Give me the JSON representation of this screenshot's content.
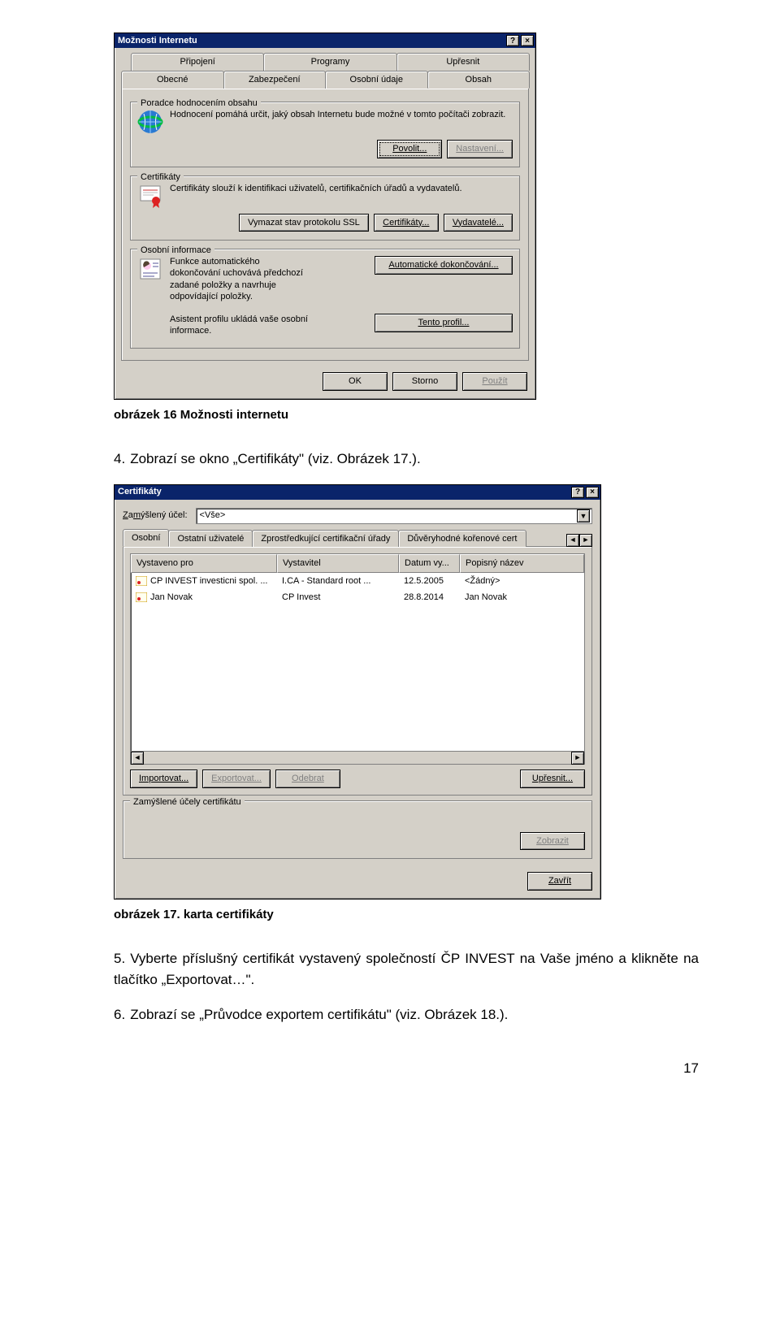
{
  "win1": {
    "title": "Možnosti Internetu",
    "help_btn": "?",
    "close_btn": "×",
    "tabs_back": [
      "Připojení",
      "Programy",
      "Upřesnit"
    ],
    "tabs_front": [
      "Obecné",
      "Zabezpečení",
      "Osobní údaje",
      "Obsah"
    ],
    "active_tab": "Obsah",
    "content_advisor": {
      "title": "Poradce hodnocením obsahu",
      "desc": "Hodnocení pomáhá určit, jaký obsah Internetu bude možné v tomto počítači zobrazit.",
      "btn_enable": "Povolit...",
      "btn_settings": "Nastavení..."
    },
    "certificates": {
      "title": "Certifikáty",
      "desc": "Certifikáty slouží k identifikaci uživatelů, certifikačních úřadů a vydavatelů.",
      "btn_clear": "Vymazat stav protokolu SSL",
      "btn_certs": "Certifikáty...",
      "btn_publishers": "Vydavatelé..."
    },
    "personal": {
      "title": "Osobní informace",
      "desc1": "Funkce automatického dokončování uchovává předchozí zadané položky a navrhuje odpovídající položky.",
      "btn_auto": "Automatické dokončování...",
      "desc2": "Asistent profilu ukládá vaše osobní informace.",
      "btn_profile": "Tento profil..."
    },
    "btn_ok": "OK",
    "btn_cancel": "Storno",
    "btn_apply": "Použít"
  },
  "cap1": "obrázek 16 Možnosti internetu",
  "text4": "Zobrazí se okno „Certifikáty\" (viz. Obrázek 17.).",
  "win2": {
    "title": "Certifikáty",
    "help_btn": "?",
    "close_btn": "×",
    "purpose_label": "Zamýšlený účel:",
    "purpose_value": "<Vše>",
    "tabs": [
      "Osobní",
      "Ostatní uživatelé",
      "Zprostředkující certifikační úřady",
      "Důvěryhodné kořenové cert"
    ],
    "active_tab": "Osobní",
    "columns": [
      "Vystaveno pro",
      "Vystavitel",
      "Datum vy...",
      "Popisný název"
    ],
    "rows": [
      {
        "c1": "CP INVEST investicni spol. ...",
        "c2": "I.CA - Standard root ...",
        "c3": "12.5.2005",
        "c4": "<Žádný>"
      },
      {
        "c1": "Jan Novak",
        "c2": "CP Invest",
        "c3": "28.8.2014",
        "c4": "Jan Novak"
      }
    ],
    "btn_import": "Importovat...",
    "btn_export": "Exportovat...",
    "btn_remove": "Odebrat",
    "btn_advanced": "Upřesnit...",
    "purposes_title": "Zamýšlené účely certifikátu",
    "btn_view": "Zobrazit",
    "btn_close": "Zavřít"
  },
  "cap2": "obrázek 17. karta certifikáty",
  "text5": "Vyberte příslušný certifikát vystavený společností ČP INVEST na Vaše jméno a klikněte na tlačítko „Exportovat…\".",
  "text6": "Zobrazí se „Průvodce exportem certifikátu\" (viz. Obrázek 18.).",
  "page_number": "17"
}
